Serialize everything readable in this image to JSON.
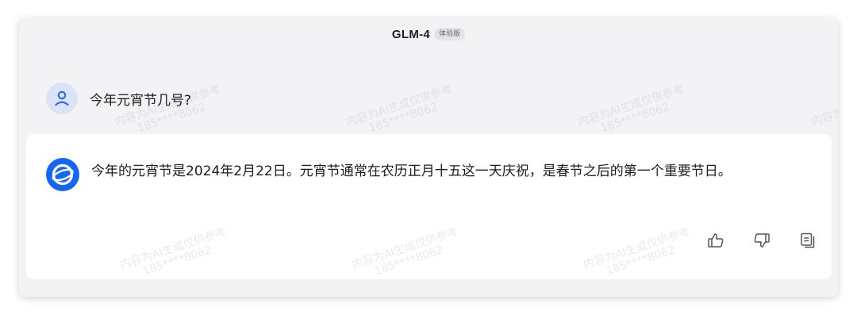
{
  "header": {
    "model_name": "GLM-4",
    "badge": "体验版"
  },
  "conversation": {
    "user_message": "今年元宵节几号?",
    "assistant_message": "今年的元宵节是2024年2月22日。元宵节通常在农历正月十五这一天庆祝，是春节之后的第一个重要节日。"
  },
  "actions": {
    "icons": [
      "thumbs-up-icon",
      "thumbs-down-icon",
      "copy-icon"
    ]
  },
  "watermark": {
    "line1": "内容为AI生成仅供参考",
    "line2": "185****8062"
  },
  "colors": {
    "accent": "#1466f5",
    "user_avatar_bg": "#dbe4f7",
    "background": "#f3f3f5"
  }
}
